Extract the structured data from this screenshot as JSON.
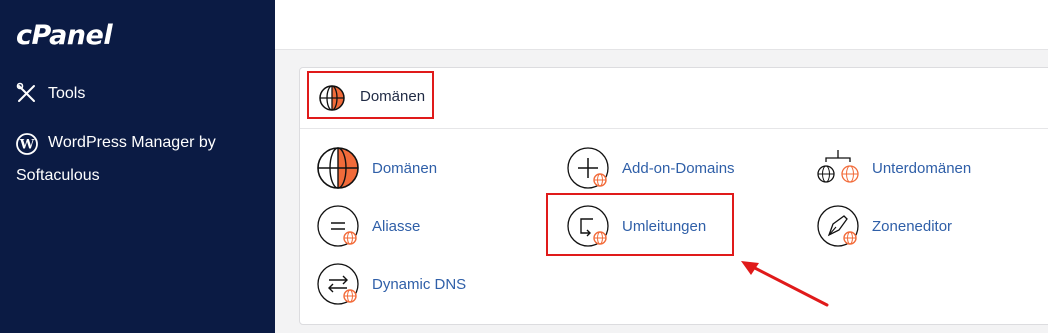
{
  "sidebar": {
    "logo": "cPanel",
    "items": [
      {
        "label": "Tools",
        "icon": "tools-icon"
      },
      {
        "label_line1": "WordPress Manager by",
        "label_line2": "Softaculous",
        "icon": "wordpress-icon"
      }
    ]
  },
  "panel": {
    "title": "Domänen",
    "items": [
      {
        "label": "Domänen",
        "icon": "globe-icon"
      },
      {
        "label": "Add-on-Domains",
        "icon": "plus-globe-icon"
      },
      {
        "label": "Unterdomänen",
        "icon": "subdomain-icon"
      },
      {
        "label": "Aliasse",
        "icon": "alias-icon"
      },
      {
        "label": "Umleitungen",
        "icon": "redirect-icon"
      },
      {
        "label": "Zoneneditor",
        "icon": "zone-editor-icon"
      },
      {
        "label": "Dynamic DNS",
        "icon": "dynamic-dns-icon"
      }
    ]
  },
  "colors": {
    "sidebar_bg": "#0b1b44",
    "accent_orange": "#f26b3a",
    "link": "#2f5fa8",
    "highlight": "#e01a1a"
  }
}
